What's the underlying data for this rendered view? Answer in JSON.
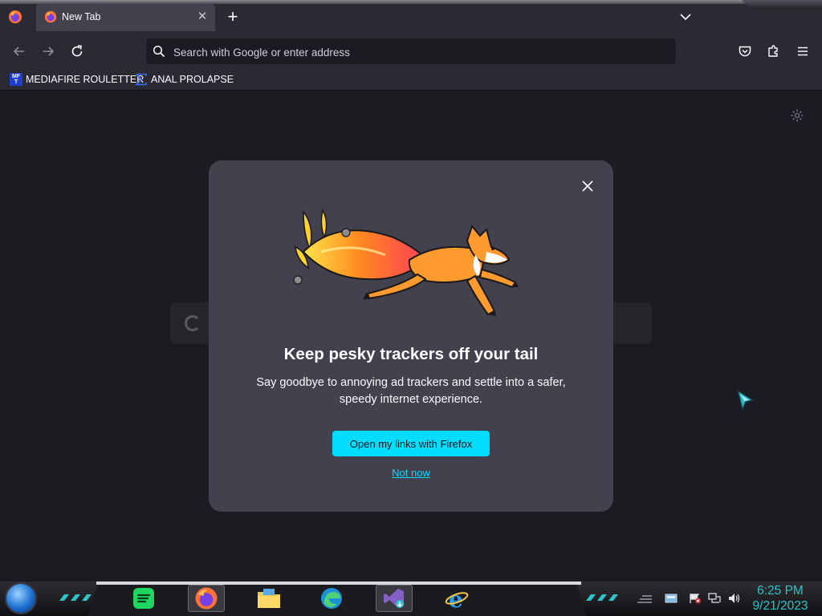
{
  "browser": {
    "tab": {
      "title": "New Tab"
    },
    "urlbar": {
      "placeholder": "Search with Google or enter address"
    },
    "bookmarks": [
      {
        "icon": "mediafire-icon",
        "icon_text": [
          "MF",
          "T"
        ],
        "label": "MEDIAFIRE ROULETTER"
      },
      {
        "icon": "sigma-icon",
        "label": "ANAL PROLAPSE"
      }
    ]
  },
  "dialog": {
    "title": "Keep pesky trackers off your tail",
    "subtitle": "Say goodbye to annoying ad trackers and settle into a safer, speedy internet experience.",
    "primary_button": "Open my links with Firefox",
    "secondary_link": "Not now"
  },
  "taskbar": {
    "pinned": [
      "spotify-icon",
      "firefox-icon",
      "file-explorer-icon",
      "edge-icon",
      "visual-studio-icon",
      "internet-explorer-icon"
    ],
    "active": "firefox-icon"
  },
  "clock": {
    "time": "6:25 PM",
    "date": "9/21/2023"
  },
  "colors": {
    "accent": "#00ddff",
    "dialog_bg": "#42414d",
    "page_bg": "#1c1b22",
    "clock": "#2ec3c9"
  }
}
